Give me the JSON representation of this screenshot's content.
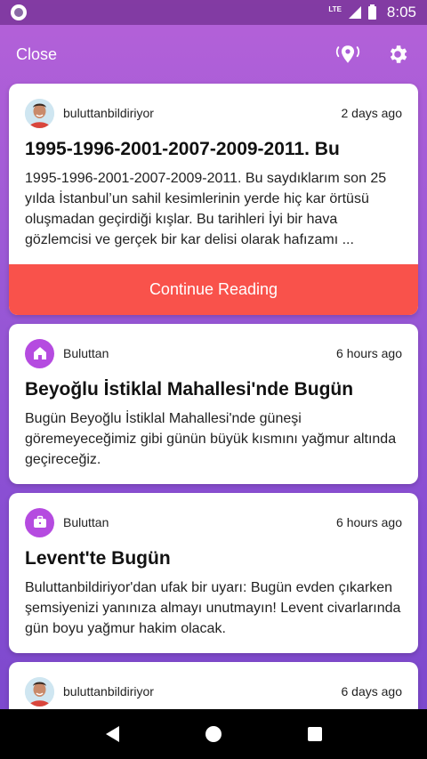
{
  "status": {
    "network": "LTE",
    "time": "8:05"
  },
  "header": {
    "close_label": "Close",
    "location_icon": "location-signal-icon",
    "settings_icon": "gear-icon"
  },
  "posts": [
    {
      "author": "buluttanbildiriyor",
      "time": "2 days ago",
      "title": "1995-1996-2001-2007-2009-2011. Bu",
      "body": "1995-1996-2001-2007-2009-2011. Bu saydıklarım son 25 yılda İstanbul’un sahil kesimlerinin yerde hiç kar örtüsü oluşmadan geçirdiği kışlar. Bu tarihleri İyi bir hava gözlemcisi ve gerçek bir kar delisi olarak hafızamı ...",
      "action": "Continue Reading"
    },
    {
      "author": "Buluttan",
      "time": "6 hours ago",
      "title": "Beyoğlu İstiklal Mahallesi'nde Bugün",
      "body": "Bugün Beyoğlu İstiklal Mahallesi'nde güneşi göremeyeceğimiz gibi günün büyük kısmını yağmur altında geçireceğiz.",
      "icon": "home-icon"
    },
    {
      "author": "Buluttan",
      "time": "6 hours ago",
      "title": "Levent'te Bugün",
      "body": "Buluttanbildiriyor'dan ufak bir uyarı: Bugün evden çıkarken şemsiyenizi yanınıza almayı unutmayın! Levent civarlarında gün boyu yağmur hakim olacak.",
      "icon": "briefcase-icon"
    },
    {
      "author": "buluttanbildiriyor",
      "time": "6 days ago"
    }
  ],
  "colors": {
    "accent": "#f9524b",
    "category_icon_bg": "#b54be0"
  }
}
